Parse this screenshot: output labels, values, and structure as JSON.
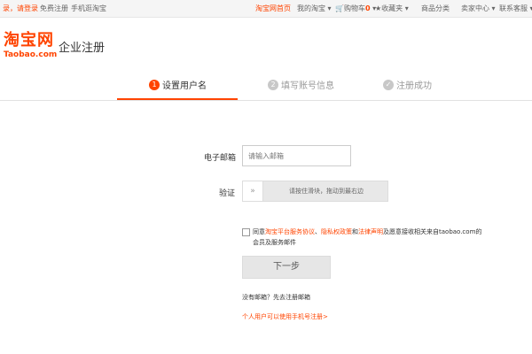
{
  "topbar": {
    "login": "录，请登录",
    "register": "免费注册",
    "mobile": "手机逛淘宝",
    "home": "淘宝网首页",
    "my_taobao": "我的淘宝",
    "cart": "购物车",
    "cart_count": "0",
    "favorites": "收藏夹",
    "categories": "商品分类",
    "seller_center": "卖家中心",
    "contact": "联系客服"
  },
  "logo": {
    "cn": "淘宝网",
    "en": "Taobao.com"
  },
  "page_title": "企业注册",
  "steps": [
    {
      "num": "1",
      "label": "设置用户名"
    },
    {
      "num": "2",
      "label": "填写账号信息"
    },
    {
      "num": "✓",
      "label": "注册成功"
    }
  ],
  "form": {
    "email_label": "电子邮箱",
    "email_placeholder": "请输入邮箱",
    "verify_label": "验证",
    "slider_text": "请按住滑块，拖动到最右边",
    "agree_prefix": "同意",
    "agree_link1": "淘宝平台服务协议",
    "agree_sep1": "、",
    "agree_link2": "隐私权政策",
    "agree_and": "和",
    "agree_link3": "法律声明",
    "agree_suffix": "及愿意接收相关来自taobao.com的会员及服务邮件",
    "next_button": "下一步",
    "no_email": "没有邮箱？先去注册邮箱",
    "personal_link": "个人用户可以使用手机号注册>"
  },
  "colors": {
    "accent": "#ff4400",
    "inactive_step": "#c8c8c8"
  }
}
